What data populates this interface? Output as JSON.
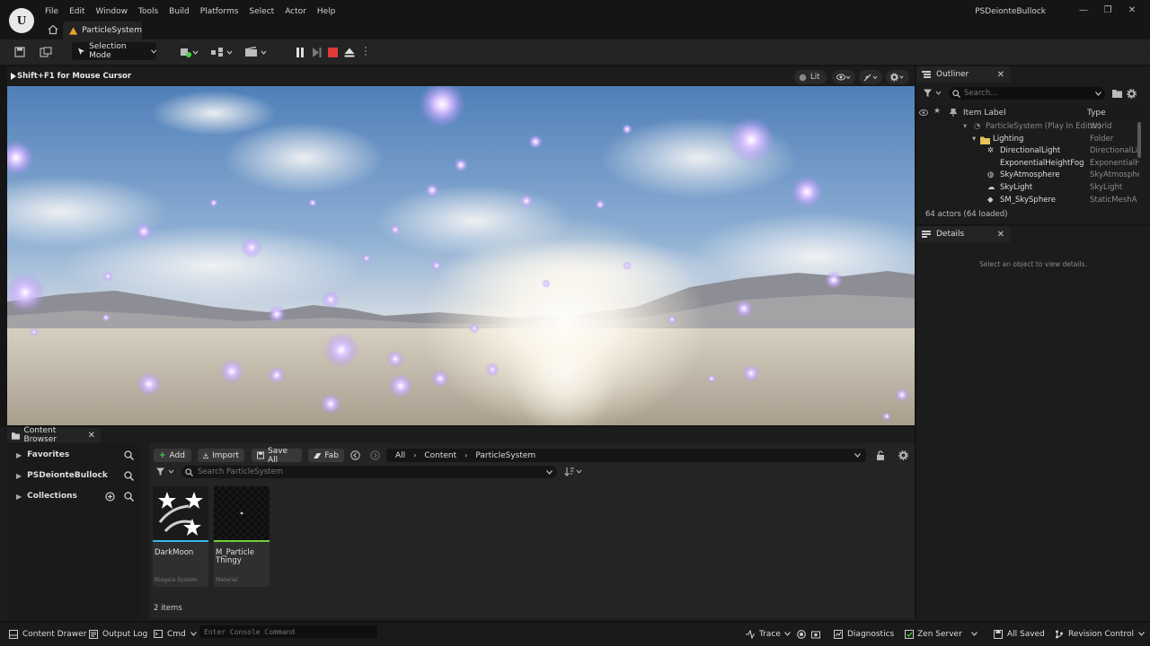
{
  "window": {
    "project_name": "PSDeionteBullock",
    "logo_text": "U",
    "controls": {
      "minimize": "—",
      "maximize": "❐",
      "close": "✕"
    }
  },
  "menu": [
    "File",
    "Edit",
    "Window",
    "Tools",
    "Build",
    "Platforms",
    "Select",
    "Actor",
    "Help"
  ],
  "level_tab": {
    "label": "ParticleSystem"
  },
  "toolbar": {
    "selection_mode": "Selection Mode",
    "play_controls": [
      "pause",
      "skip-frame",
      "stop",
      "eject"
    ]
  },
  "viewport": {
    "hint": "Shift+F1 for Mouse Cursor",
    "lit_label": "Lit"
  },
  "outliner": {
    "tab_label": "Outliner",
    "search_placeholder": "Search...",
    "columns": {
      "label": "Item Label",
      "type": "Type"
    },
    "rows": [
      {
        "name": "ParticleSystem (Play In Editor)",
        "type": "World"
      },
      {
        "name": "Lighting",
        "type": "Folder"
      },
      {
        "name": "DirectionalLight",
        "type": "DirectionalLight"
      },
      {
        "name": "ExponentialHeightFog",
        "type": "ExponentialHeightFog"
      },
      {
        "name": "SkyAtmosphere",
        "type": "SkyAtmosphere"
      },
      {
        "name": "SkyLight",
        "type": "SkyLight"
      },
      {
        "name": "SM_SkySphere",
        "type": "StaticMeshActor"
      }
    ],
    "actor_count": "64 actors (64 loaded)"
  },
  "details": {
    "tab_label": "Details",
    "empty_message": "Select an object to view details."
  },
  "content_browser": {
    "tab_label": "Content Browser",
    "sidebar": [
      {
        "label": "Favorites"
      },
      {
        "label": "PSDeionteBullock"
      },
      {
        "label": "Collections"
      }
    ],
    "buttons": {
      "add": "Add",
      "import": "Import",
      "save_all": "Save All",
      "fab": "Fab"
    },
    "breadcrumb": [
      "All",
      "Content",
      "ParticleSystem"
    ],
    "search_placeholder": "Search ParticleSystem",
    "assets": [
      {
        "name": "DarkMoon",
        "type": "Niagara System",
        "accent": "#3ab4e8"
      },
      {
        "name": "M_Particle Thingy",
        "type": "Material",
        "accent": "#6fcf3a"
      }
    ],
    "item_count": "2 items"
  },
  "statusbar": {
    "content_drawer": "Content Drawer",
    "output_log": "Output Log",
    "cmd": "Cmd",
    "console_placeholder": "Enter Console Command",
    "trace": "Trace",
    "diagnostics": "Diagnostics",
    "zen_server": "Zen Server",
    "all_saved": "All Saved",
    "revision_control": "Revision Control"
  },
  "colors": {
    "stop_red": "#e03a3a",
    "zen_green": "#3cc83c",
    "add_green": "#4bd34b",
    "folder_yellow": "#e5c25a",
    "particle_violet": "#c9a8ff"
  }
}
